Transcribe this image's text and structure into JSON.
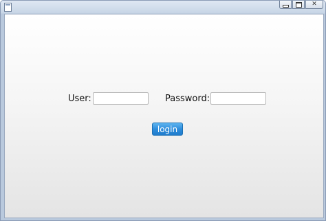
{
  "window": {
    "title": "",
    "icons": {
      "app": "app-icon",
      "minimize": "minimize-icon",
      "maximize": "maximize-icon",
      "close": "close-icon"
    },
    "close_glyph": "✕"
  },
  "form": {
    "user_label": "User:",
    "user_value": "",
    "password_label": "Password:",
    "password_value": "",
    "login_label": "login"
  },
  "colors": {
    "button_accent": "#2e8ddc",
    "window_frame": "#b9c9dd"
  }
}
